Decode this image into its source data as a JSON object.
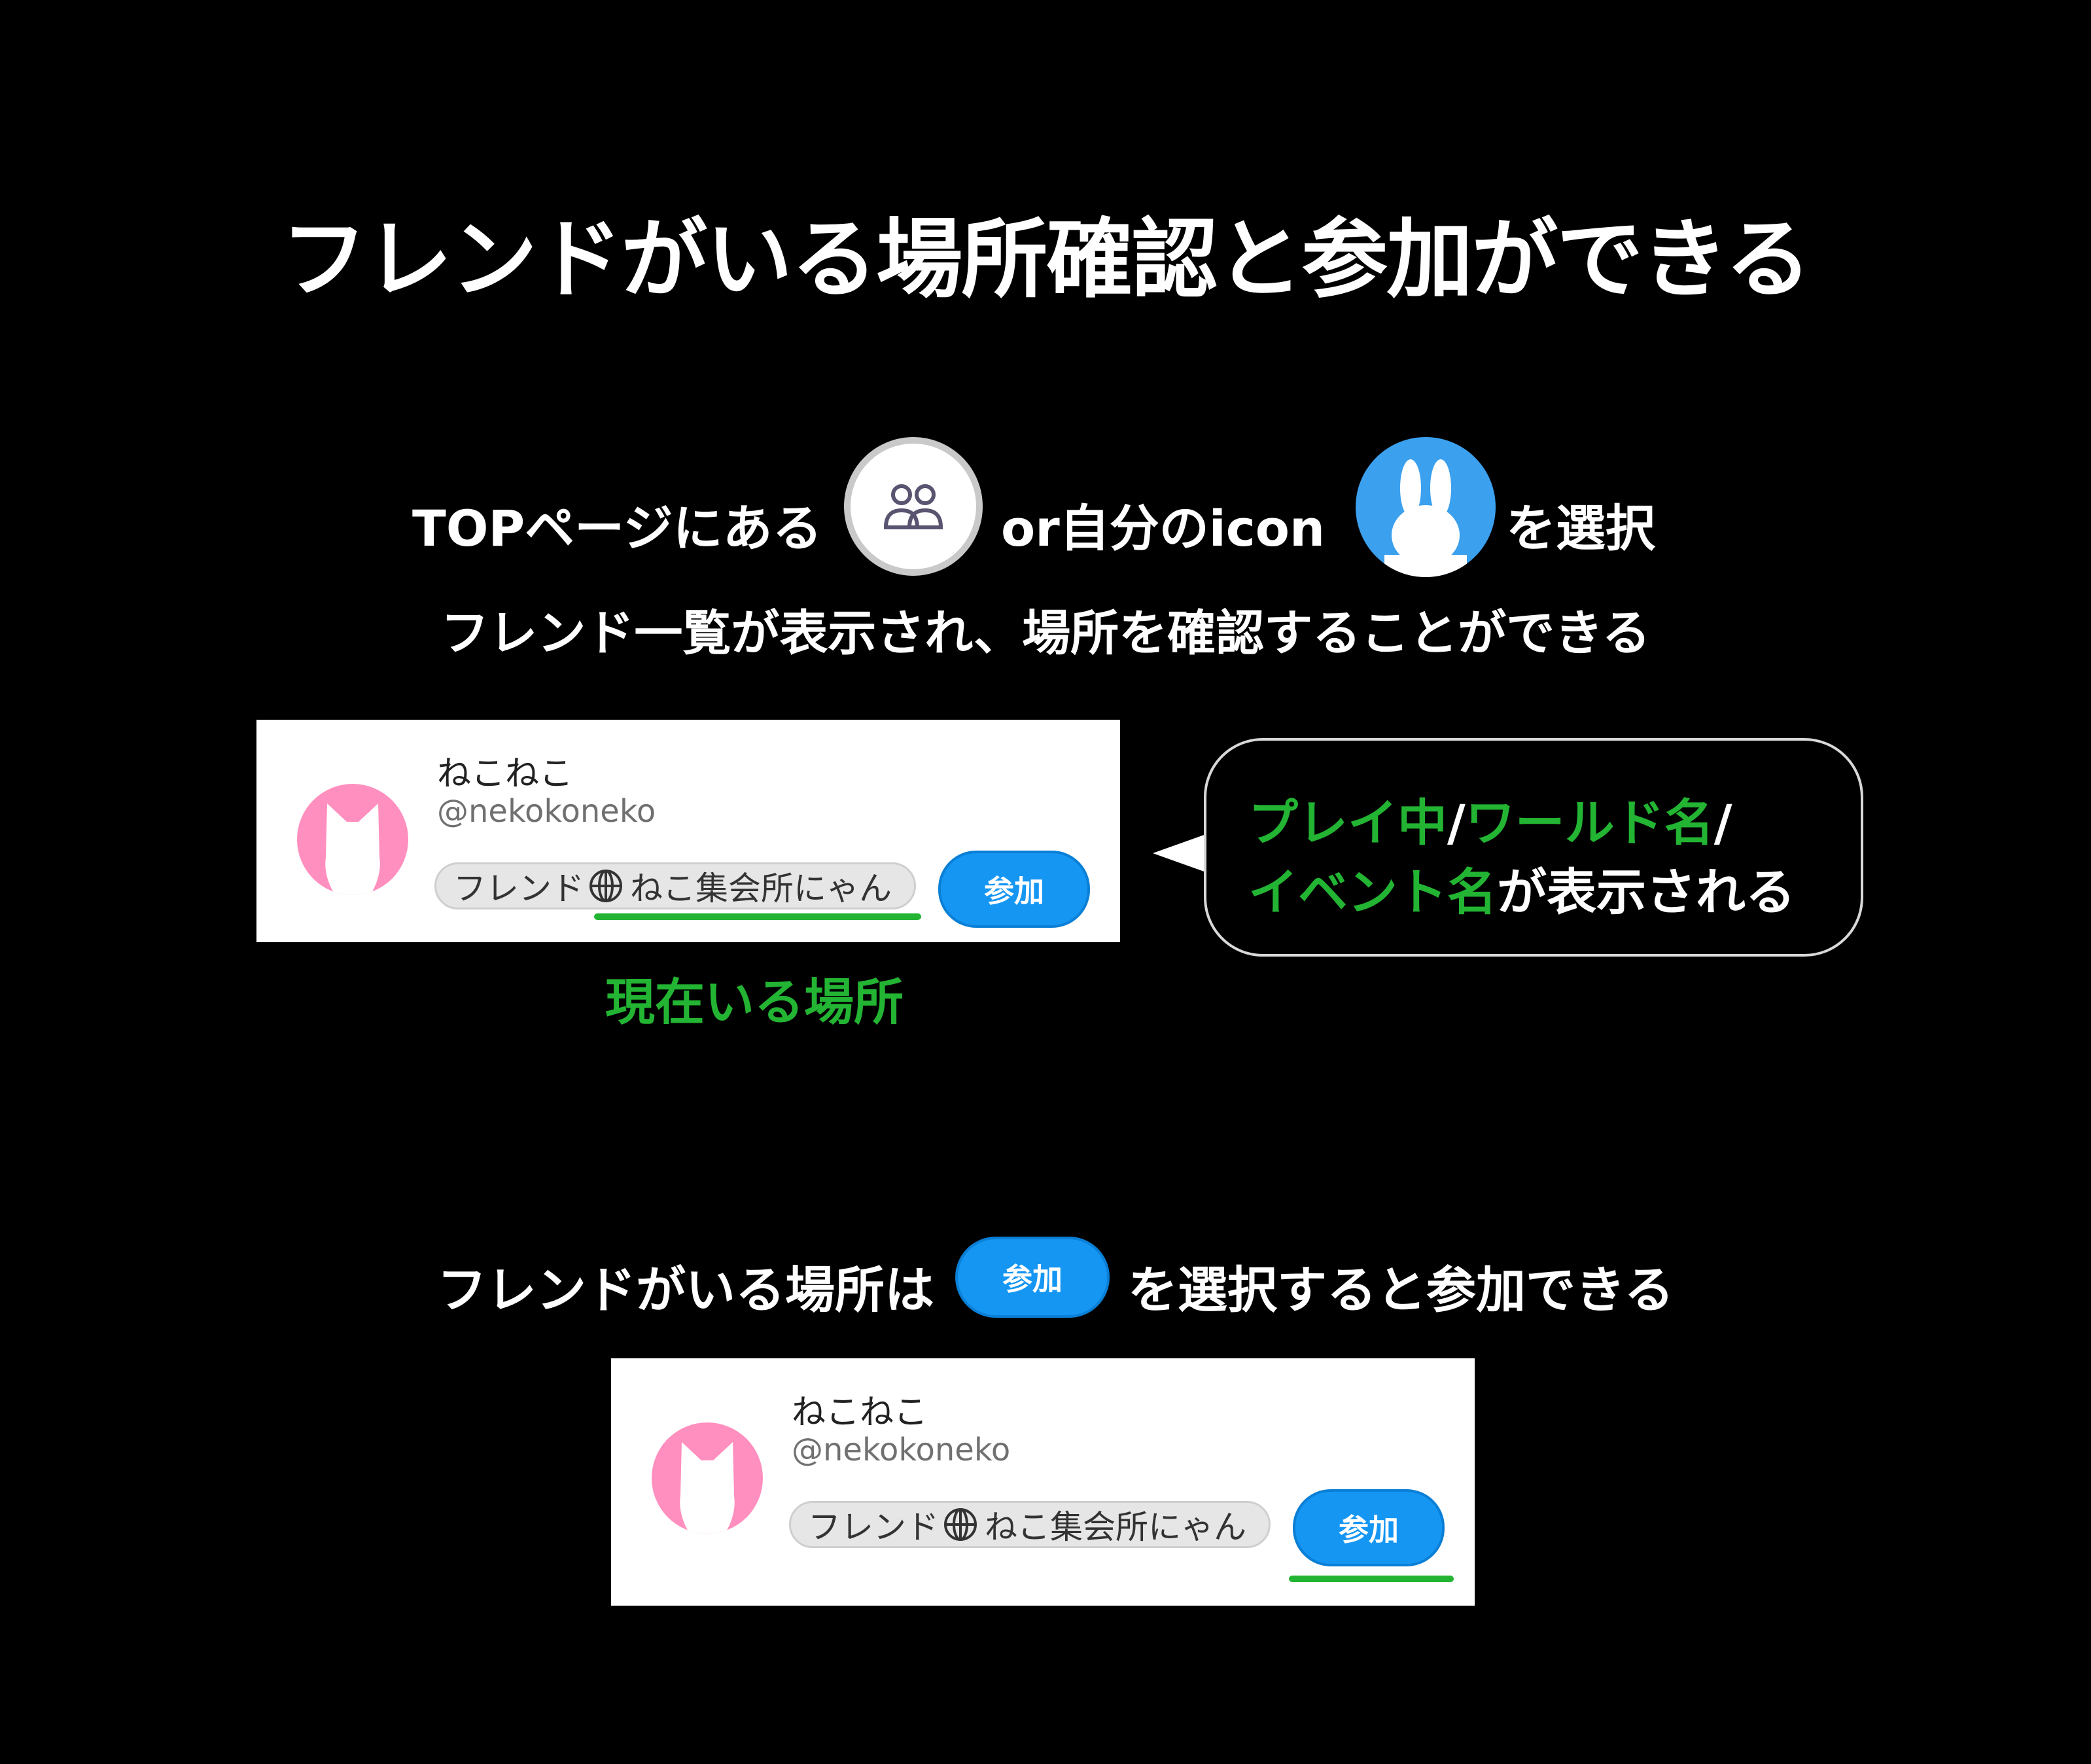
{
  "title": "フレンドがいる場所確認と参加ができる",
  "instruction1": {
    "prefix": "TOPページにある",
    "middle": "or自分のicon",
    "suffix": "を選択"
  },
  "instruction2": "フレンド一覧が表示され、場所を確認することができる",
  "friend_card": {
    "name": "ねこねこ",
    "handle": "@nekokoneko",
    "location_type": "フレンド",
    "location_name": "ねこ集会所にゃん",
    "join_label": "参加"
  },
  "current_location_label": "現在いる場所",
  "bubble": {
    "part1": "プレイ中",
    "sep1": "/",
    "part2": "ワールド名",
    "sep2": "/",
    "part3": "イベント名",
    "part4": "が表示される"
  },
  "instruction3": {
    "prefix": "フレンドがいる場所は",
    "button": "参加",
    "suffix": "を選択すると参加できる"
  },
  "colors": {
    "background": "#000000",
    "accent_green": "#22b432",
    "join_blue": "#1596f3",
    "avatar_pink": "#ff8fbe",
    "self_avatar_blue": "#3ba0ee"
  },
  "icons": [
    "friends-icon",
    "rabbit-avatar-icon",
    "cat-avatar-icon",
    "globe-icon"
  ]
}
